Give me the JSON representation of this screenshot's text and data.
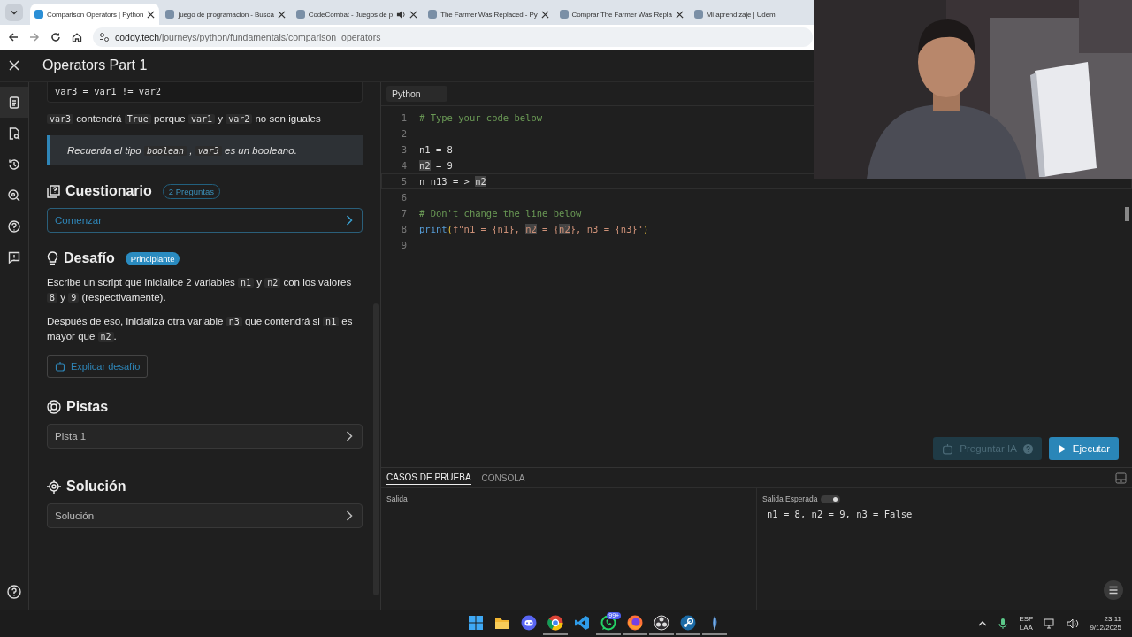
{
  "browser": {
    "tabs": [
      {
        "title": "Comparison Operators | Python",
        "selected": true,
        "audio": false
      },
      {
        "title": "juego de programacion - Busca",
        "selected": false,
        "audio": false
      },
      {
        "title": "CodeCombat - Juegos de p",
        "selected": false,
        "audio": true
      },
      {
        "title": "The Farmer Was Replaced - Py",
        "selected": false,
        "audio": false
      },
      {
        "title": "Comprar The Farmer Was Repla",
        "selected": false,
        "audio": false
      },
      {
        "title": "Mi aprendizaje | Udem",
        "selected": false,
        "audio": false
      }
    ],
    "address_host": "coddy.tech",
    "address_path": "/journeys/python/fundamentals/comparison_operators"
  },
  "app": {
    "title": "Operators Part 1"
  },
  "rail": {
    "items": [
      {
        "kind": "lesson",
        "selected": true
      },
      {
        "kind": "review",
        "selected": false
      },
      {
        "kind": "history",
        "selected": false
      },
      {
        "kind": "inspect",
        "selected": false
      },
      {
        "kind": "help",
        "selected": false
      },
      {
        "kind": "report",
        "selected": false
      }
    ]
  },
  "lesson": {
    "code_snippet": "var3 = var1 != var2",
    "note": [
      {
        "t": "var3",
        "kind": "code"
      },
      {
        "t": " contendrá ",
        "kind": "text"
      },
      {
        "t": "True",
        "kind": "code"
      },
      {
        "t": " porque ",
        "kind": "text"
      },
      {
        "t": "var1",
        "kind": "code"
      },
      {
        "t": " y ",
        "kind": "text"
      },
      {
        "t": "var2",
        "kind": "code"
      },
      {
        "t": " no son iguales",
        "kind": "text"
      }
    ],
    "callout": [
      {
        "t": "Recuerda el tipo ",
        "kind": "text"
      },
      {
        "t": "boolean",
        "kind": "code"
      },
      {
        "t": " , ",
        "kind": "text"
      },
      {
        "t": "var3",
        "kind": "code"
      },
      {
        "t": " es un booleano.",
        "kind": "text"
      }
    ],
    "quiz": {
      "heading": "Cuestionario",
      "badge": "2 Preguntas",
      "button": "Comenzar"
    },
    "challenge": {
      "heading": "Desafío",
      "badge": "Principiante",
      "paragraphs": [
        [
          {
            "t": "Escribe un script que inicialice 2 variables ",
            "kind": "text"
          },
          {
            "t": "n1",
            "kind": "code"
          },
          {
            "t": " y ",
            "kind": "text"
          },
          {
            "t": "n2",
            "kind": "code"
          },
          {
            "t": " con los valores ",
            "kind": "text"
          },
          {
            "t": "8",
            "kind": "code"
          },
          {
            "t": " y ",
            "kind": "text"
          },
          {
            "t": "9",
            "kind": "code"
          },
          {
            "t": " (respectivamente).",
            "kind": "text"
          }
        ],
        [
          {
            "t": "Después de eso, inicializa otra variable ",
            "kind": "text"
          },
          {
            "t": "n3",
            "kind": "code"
          },
          {
            "t": " que contendrá si ",
            "kind": "text"
          },
          {
            "t": "n1",
            "kind": "code"
          },
          {
            "t": " es mayor que ",
            "kind": "text"
          },
          {
            "t": "n2",
            "kind": "code"
          },
          {
            "t": ".",
            "kind": "text"
          }
        ]
      ],
      "button": "Explicar desafío"
    },
    "hints": {
      "heading": "Pistas",
      "items": [
        "Pista 1"
      ]
    },
    "solution": {
      "heading": "Solución",
      "items": [
        "Solución"
      ]
    }
  },
  "editor": {
    "language": "Python",
    "lines": [
      {
        "number": "1",
        "active": false,
        "tokens": [
          {
            "text": "# Type your code below",
            "kind": "comment",
            "highlight": false
          }
        ]
      },
      {
        "number": "2",
        "active": false
      },
      {
        "number": "3",
        "active": false,
        "tokens": [
          {
            "text": "n1 = 8",
            "kind": "plain",
            "highlight": false
          }
        ]
      },
      {
        "number": "4",
        "active": false,
        "tokens": [
          {
            "text": "n2",
            "kind": "plain",
            "highlight": true
          },
          {
            "text": " = 9",
            "kind": "plain",
            "highlight": false
          }
        ]
      },
      {
        "number": "5",
        "active": true,
        "tokens": [
          {
            "text": "n n13 = > ",
            "kind": "plain",
            "highlight": false
          },
          {
            "text": "n2",
            "kind": "plain",
            "highlight": true
          }
        ]
      },
      {
        "number": "6",
        "active": false
      },
      {
        "number": "7",
        "active": false,
        "tokens": [
          {
            "text": "# Don't change the line below",
            "kind": "comment",
            "highlight": false
          }
        ]
      },
      {
        "number": "8",
        "active": false,
        "tokens": [
          {
            "text": "print",
            "kind": "func",
            "highlight": false
          },
          {
            "text": "(",
            "kind": "paren",
            "highlight": false
          },
          {
            "text": "f\"n1 = {n1}, ",
            "kind": "string",
            "highlight": false
          },
          {
            "text": "n2",
            "kind": "string",
            "highlight": true
          },
          {
            "text": " = {",
            "kind": "string",
            "highlight": false
          },
          {
            "text": "n2",
            "kind": "string",
            "highlight": true
          },
          {
            "text": "}, n3 = {n3}\"",
            "kind": "string",
            "highlight": false
          },
          {
            "text": ")",
            "kind": "paren",
            "highlight": false
          }
        ]
      },
      {
        "number": "9",
        "active": false
      }
    ],
    "actions": [
      {
        "label": "Preguntar IA",
        "kind": "ai",
        "disabled": true
      },
      {
        "label": "Ejecutar",
        "kind": "run",
        "disabled": false
      }
    ]
  },
  "results": {
    "tabs": [
      {
        "label": "CASOS DE PRUEBA",
        "selected": true
      },
      {
        "label": "CONSOLA",
        "selected": false
      }
    ],
    "output_label": "Salida",
    "expected_label": "Salida Esperada",
    "expected_toggle_on": true,
    "expected": "n1 = 8, n2 = 9, n3 = False"
  },
  "taskbar": {
    "apps": [
      {
        "kind": "start",
        "running": false
      },
      {
        "kind": "files",
        "running": false
      },
      {
        "kind": "discord",
        "running": false
      },
      {
        "kind": "browser",
        "running": true
      },
      {
        "kind": "code",
        "running": false
      },
      {
        "kind": "chat",
        "running": true,
        "badge": "99+"
      },
      {
        "kind": "fox",
        "running": true
      },
      {
        "kind": "record",
        "running": true
      },
      {
        "kind": "steam",
        "running": true
      },
      {
        "kind": "feather",
        "running": true
      }
    ],
    "language": "ESP",
    "layout": "LAA",
    "time": "23:11",
    "date": "9/12/2025"
  }
}
